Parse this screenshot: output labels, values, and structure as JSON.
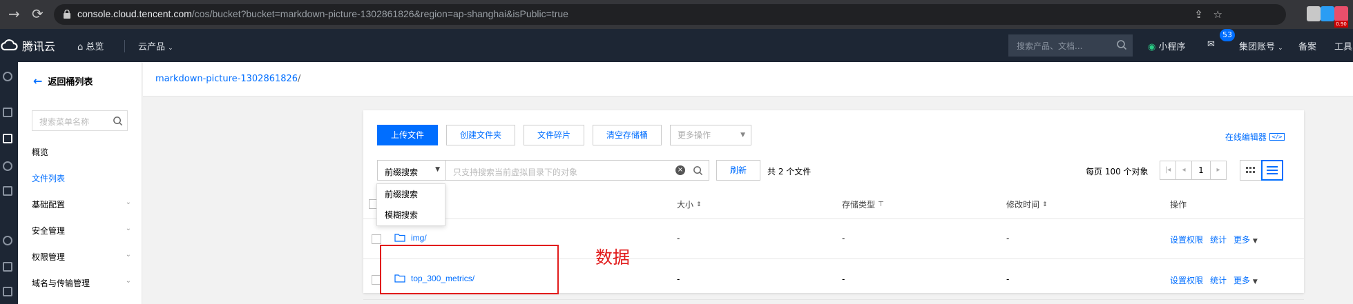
{
  "browser": {
    "url_host": "console.cloud.tencent.com",
    "url_path": "/cos/bucket?bucket=markdown-picture-1302861826&region=ap-shanghai&isPublic=true",
    "ext_badge": "0.90"
  },
  "topbar": {
    "logo": "腾讯云",
    "overview": "总览",
    "products": "云产品",
    "search_placeholder": "搜索产品、文档...",
    "mini_program": "小程序",
    "message_count": "53",
    "account": "集团账号",
    "filing": "备案",
    "tools": "工具"
  },
  "sidebar": {
    "back": "返回桶列表",
    "search_placeholder": "搜索菜单名称",
    "items": [
      {
        "label": "概览"
      },
      {
        "label": "文件列表"
      },
      {
        "label": "基础配置"
      },
      {
        "label": "安全管理"
      },
      {
        "label": "权限管理"
      },
      {
        "label": "域名与传输管理"
      }
    ]
  },
  "breadcrumb": {
    "bucket": "markdown-picture-1302861826",
    "sep": "/"
  },
  "toolbar": {
    "upload": "上传文件",
    "create_folder": "创建文件夹",
    "fragments": "文件碎片",
    "empty_bucket": "清空存储桶",
    "more_ops": "更多操作",
    "online_editor": "在线编辑器"
  },
  "filter": {
    "mode": "前缀搜索",
    "search_placeholder": "只支持搜索当前虚拟目录下的对象",
    "refresh": "刷新",
    "count": "共 2 个文件",
    "per_page": "每页 100 个对象",
    "page": "1"
  },
  "dropdown": {
    "options": [
      "前缀搜索",
      "模糊搜索"
    ]
  },
  "table": {
    "headers": {
      "size": "大小",
      "storage": "存储类型",
      "modified": "修改时间",
      "actions": "操作"
    },
    "rows": [
      {
        "name": "img/",
        "size": "-",
        "storage": "-",
        "modified": "-",
        "perm": "设置权限",
        "stats": "统计",
        "more": "更多"
      },
      {
        "name": "top_300_metrics/",
        "size": "-",
        "storage": "-",
        "modified": "-",
        "perm": "设置权限",
        "stats": "统计",
        "more": "更多"
      }
    ]
  },
  "annotation": {
    "label": "数据",
    "color": "#e11b1b"
  },
  "colors": {
    "accent": "#006eff",
    "topbar": "#1d2634",
    "chrome": "#35363a"
  }
}
